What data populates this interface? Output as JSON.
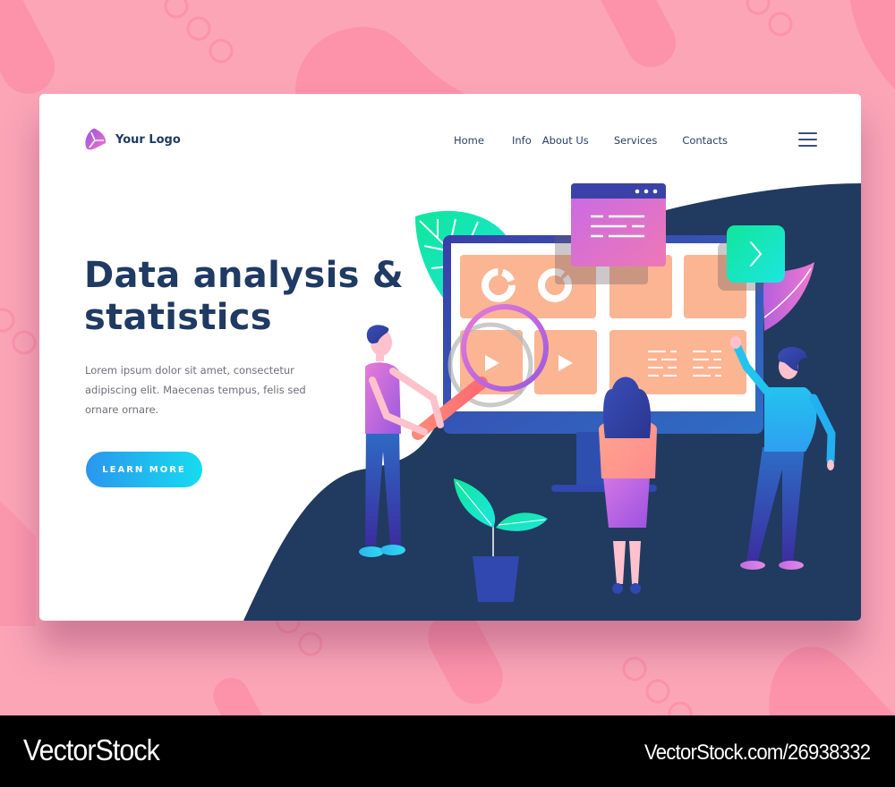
{
  "header": {
    "logo_icon": "triangle-petal-logo-icon",
    "logo_text": "Your Logo",
    "nav": [
      {
        "label": "Home"
      },
      {
        "label": "Info"
      },
      {
        "label": "About Us"
      },
      {
        "label": "Services"
      },
      {
        "label": "Contacts"
      }
    ],
    "menu_icon": "hamburger-menu-icon"
  },
  "hero": {
    "title_lines": [
      "Data analysis &",
      "statistics"
    ],
    "body": "Lorem ipsum dolor sit amet, consectetur adipiscing elit. Maecenas tempus, felis sed ornare ornare.",
    "cta_label": "LEARN MORE"
  },
  "illustration": {
    "monitor_panels": [
      "donut-charts-panel",
      "blank-panel",
      "blank-panel",
      "play-video-panel",
      "play-video-panel",
      "text-lines-panel"
    ],
    "popup_window_icon": "browser-window-icon",
    "next_button_icon": "chevron-right-icon",
    "people": [
      "man-with-magnifier",
      "woman-standing",
      "man-pointing"
    ],
    "plant": "potted-plant"
  },
  "colors": {
    "background_pink": "#fba5b7",
    "navy": "#1f3a63",
    "cta_gradient_start": "#2b96ee",
    "cta_gradient_end": "#16dcef",
    "panel_peach": "#fbb592",
    "accent_green": "#1ee8b0",
    "accent_purple": "#c46be0"
  },
  "watermark": {
    "brand": "VectorStock",
    "url": "VectorStock.com/26938332"
  }
}
